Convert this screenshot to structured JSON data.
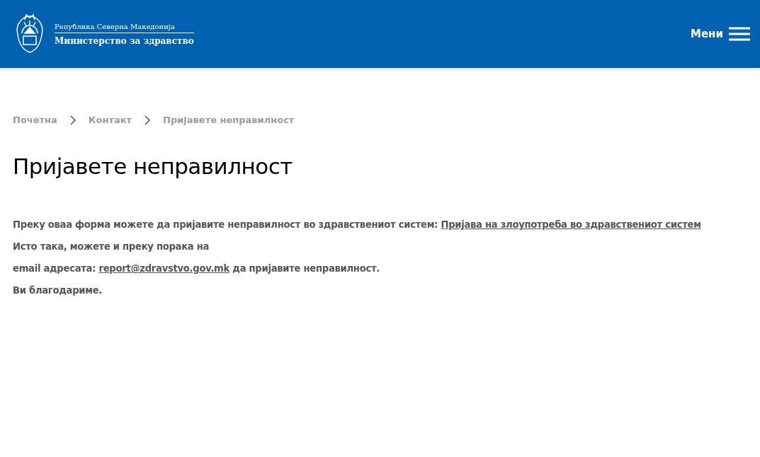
{
  "header": {
    "country": "Република Северна Македонија",
    "ministry": "Министерство за здравство",
    "menu_label": "Мени"
  },
  "breadcrumb": [
    "Почетна",
    "Контакт",
    "Пријавете неправилност"
  ],
  "title": "Пријавете неправилност",
  "paragraphs": [
    {
      "parts": [
        {
          "text": "Преку оваа форма можете да пријавите неправилност во здравствениот систем: ",
          "link": false
        },
        {
          "text": "Пријава на злоупотреба во здравствениот систем",
          "link": true
        }
      ]
    },
    {
      "parts": [
        {
          "text": "Исто така, можете и преку порака на",
          "link": false
        }
      ]
    },
    {
      "parts": [
        {
          "text": "email адресата: ",
          "link": false
        },
        {
          "text": "report@zdravstvo.gov.mk",
          "link": true
        },
        {
          "text": " да пријавите неправилност.",
          "link": false
        }
      ]
    },
    {
      "parts": [
        {
          "text": "Ви благодариме.",
          "link": false
        }
      ]
    }
  ]
}
